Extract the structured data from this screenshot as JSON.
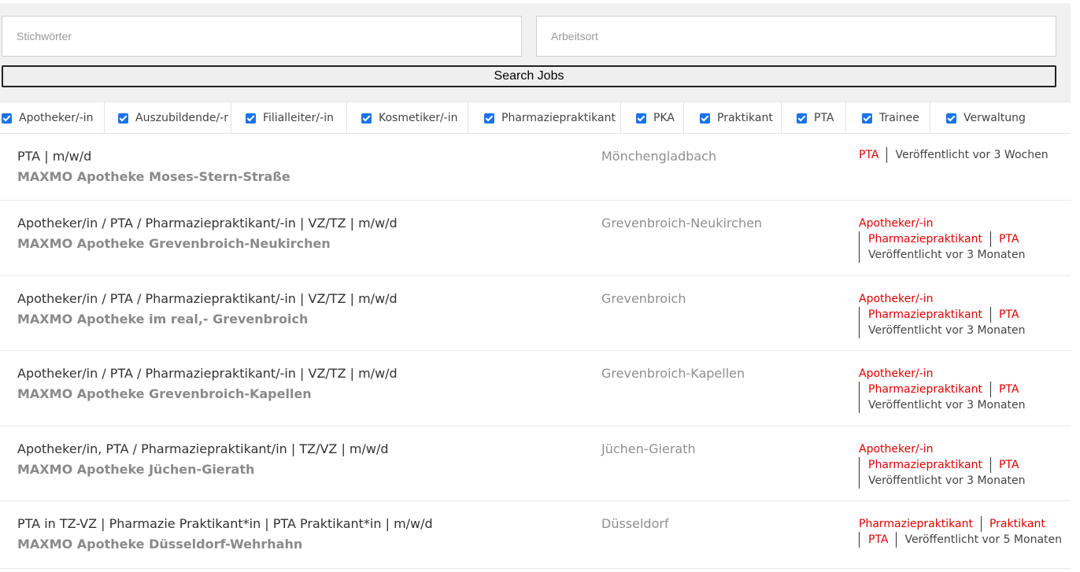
{
  "search": {
    "keywords_placeholder": "Stichwörter",
    "location_placeholder": "Arbeitsort",
    "button_label": "Search Jobs"
  },
  "filters": [
    {
      "label": "Apotheker/-in",
      "checked": true
    },
    {
      "label": "Auszubildende/-r",
      "checked": true
    },
    {
      "label": "Filialleiter/-in",
      "checked": true
    },
    {
      "label": "Kosmetiker/-in",
      "checked": true
    },
    {
      "label": "Pharmaziepraktikant",
      "checked": true
    },
    {
      "label": "PKA",
      "checked": true
    },
    {
      "label": "Praktikant",
      "checked": true
    },
    {
      "label": "PTA",
      "checked": true
    },
    {
      "label": "Trainee",
      "checked": true
    },
    {
      "label": "Verwaltung",
      "checked": true
    }
  ],
  "jobs": [
    {
      "title": "PTA | m/w/d",
      "company": "MAXMO Apotheke Moses-Stern-Straße",
      "location": "Mönchengladbach",
      "tags": [
        "PTA"
      ],
      "published": "Veröffentlicht vor 3 Wochen"
    },
    {
      "title": "Apotheker/in / PTA / Pharmaziepraktikant/-in | VZ/TZ | m/w/d",
      "company": "MAXMO Apotheke Grevenbroich-Neukirchen",
      "location": "Grevenbroich-Neukirchen",
      "tags": [
        "Apotheker/-in",
        "Pharmaziepraktikant",
        "PTA"
      ],
      "published": "Veröffentlicht vor 3 Monaten"
    },
    {
      "title": "Apotheker/in / PTA / Pharmaziepraktikant/-in | VZ/TZ | m/w/d",
      "company": "MAXMO Apotheke im real,- Grevenbroich",
      "location": "Grevenbroich",
      "tags": [
        "Apotheker/-in",
        "Pharmaziepraktikant",
        "PTA"
      ],
      "published": "Veröffentlicht vor 3 Monaten"
    },
    {
      "title": "Apotheker/in / PTA / Pharmaziepraktikant/-in | VZ/TZ | m/w/d",
      "company": "MAXMO Apotheke Grevenbroich-Kapellen",
      "location": "Grevenbroich-Kapellen",
      "tags": [
        "Apotheker/-in",
        "Pharmaziepraktikant",
        "PTA"
      ],
      "published": "Veröffentlicht vor 3 Monaten"
    },
    {
      "title": "Apotheker/in, PTA / Pharmaziepraktikant/in | TZ/VZ | m/w/d",
      "company": "MAXMO Apotheke Jüchen-Gierath",
      "location": "Jüchen-Gierath",
      "tags": [
        "Apotheker/-in",
        "Pharmaziepraktikant",
        "PTA"
      ],
      "published": "Veröffentlicht vor 3 Monaten"
    },
    {
      "title": "PTA in TZ-VZ | Pharmazie Praktikant*in | PTA Praktikant*in | m/w/d",
      "company": "MAXMO Apotheke Düsseldorf-Wehrhahn",
      "location": "Düsseldorf",
      "tags": [
        "Pharmaziepraktikant",
        "Praktikant",
        "PTA"
      ],
      "published": "Veröffentlicht vor 5 Monaten"
    }
  ]
}
